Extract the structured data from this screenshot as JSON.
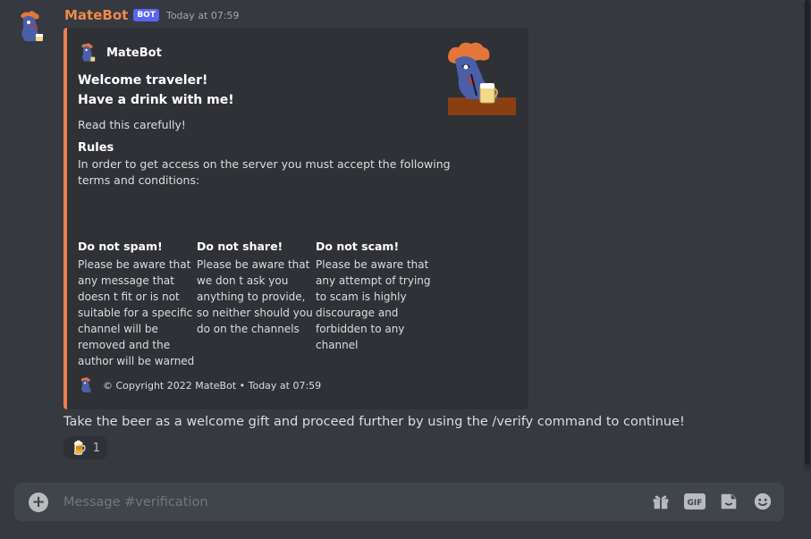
{
  "message": {
    "username": "MateBot",
    "bot_tag": "BOT",
    "timestamp": "Today at 07:59",
    "avatar_icon": "matebot-avatar-icon",
    "embed": {
      "accent_color": "#f07e4b",
      "author": "MateBot",
      "title_line1": "Welcome traveler!",
      "title_line2": "Have a drink with me!",
      "description": "Read this carefully!",
      "rules_title": "Rules",
      "rules_line1": "In order to get access on the server you must accept the following",
      "rules_line2": "terms and conditions:",
      "fields": [
        {
          "name": "Do not spam!",
          "lines": [
            "Please be aware that",
            "any message that",
            "doesn t fit or is not",
            "suitable for a specific",
            "channel will be",
            "removed and the",
            "author will be warned"
          ]
        },
        {
          "name": "Do not share!",
          "lines": [
            "Please be aware that",
            "we don t ask you",
            "anything to provide,",
            "so neither should you",
            "do on the channels"
          ]
        },
        {
          "name": "Do not scam!",
          "lines": [
            "Please be aware that",
            "any attempt of trying",
            "to scam is highly",
            "discourage and",
            "forbidden to any",
            "channel"
          ]
        }
      ],
      "footer": "© Copyright 2022 MateBot • Today at 07:59"
    },
    "content": "Take the beer as a welcome gift and proceed further by using the /verify command to continue!",
    "reaction": {
      "emoji": "🍺",
      "count": "1"
    }
  },
  "composer": {
    "placeholder": "Message #verification",
    "icons": [
      "add-icon",
      "gift-icon",
      "gif-icon",
      "sticker-icon",
      "emoji-icon"
    ]
  },
  "colors": {
    "background": "#36393f",
    "embed_bg": "#2f3136",
    "username": "#f0894b",
    "bot_tag": "#5865f2"
  }
}
